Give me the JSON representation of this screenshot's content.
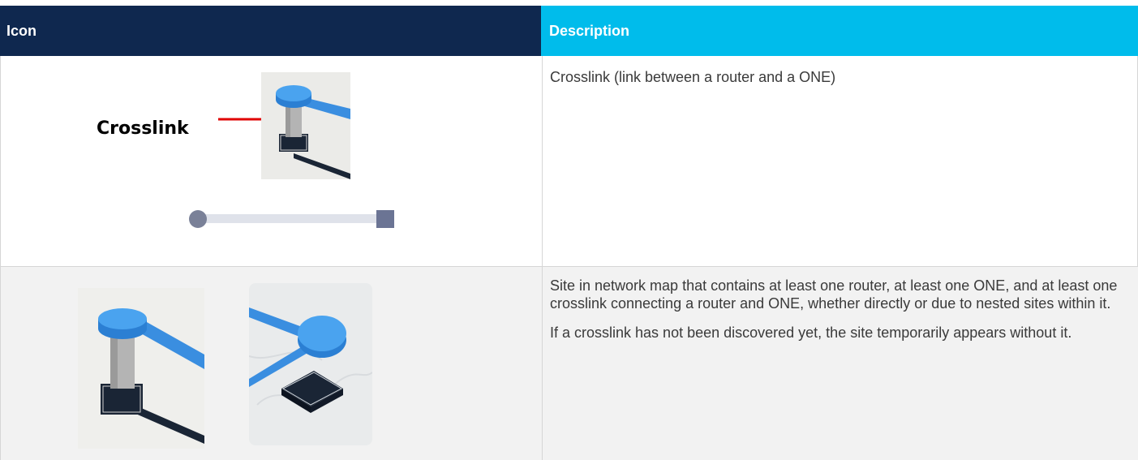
{
  "table": {
    "headers": {
      "icon": "Icon",
      "description": "Description"
    },
    "rows": [
      {
        "icon_label": "Crosslink",
        "description": [
          "Crosslink (link between a router and a ONE)"
        ]
      },
      {
        "description": [
          "Site in network map that contains at least one router, at least one ONE, and at least one crosslink connecting a router and ONE, whether directly or due to nested sites within it.",
          "If a crosslink has not been discovered yet, the site temporarily appears without it."
        ]
      }
    ]
  },
  "colors": {
    "header_dark": "#0f284f",
    "header_light": "#00bceb",
    "router_blue": "#3a8ee0",
    "one_dark": "#1a2535",
    "arrow_red": "#e00000"
  }
}
